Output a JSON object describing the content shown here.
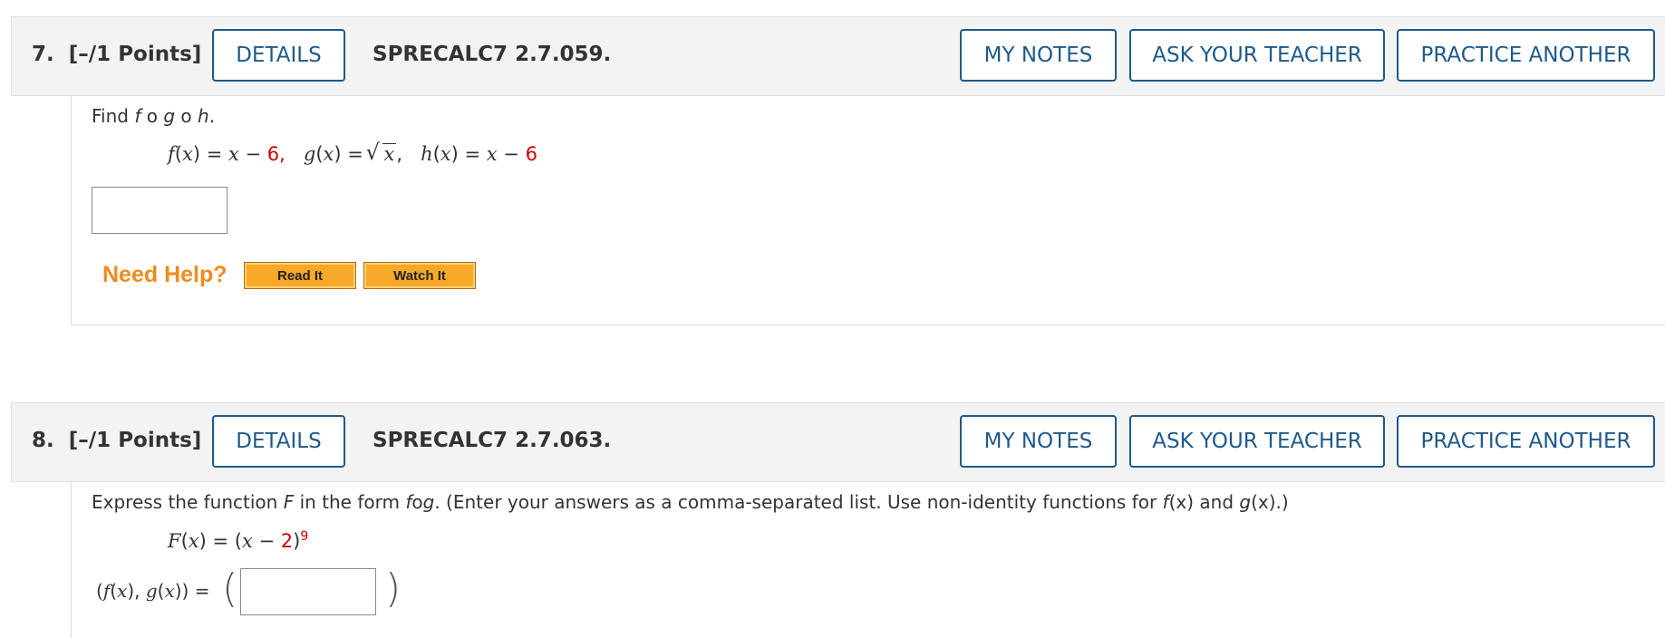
{
  "q7": {
    "number": "7.",
    "points": "[–/1 Points]",
    "details_label": "DETAILS",
    "code": "SPRECALC7 2.7.059.",
    "my_notes_label": "MY NOTES",
    "ask_teacher_label": "ASK YOUR TEACHER",
    "practice_label": "PRACTICE ANOTHER",
    "prompt": {
      "find": "Find ",
      "f": "f",
      "circ1": " o ",
      "g": "g",
      "circ2": " o ",
      "h": "h",
      "period": "."
    },
    "math": {
      "f_lhs": "f",
      "f_mid": "(",
      "f_x": "x",
      "f_eq": ") = ",
      "f_x2": "x",
      "f_minus": " − ",
      "f_const": "6",
      "comma1": ",",
      "g_lhs": "g",
      "g_open": "(",
      "g_x": "x",
      "g_eq": ") = ",
      "g_rad": "x",
      "comma2": ",",
      "h_lhs": "h",
      "h_open": "(",
      "h_x": "x",
      "h_eq": ") = ",
      "h_x2": "x",
      "h_minus": " − ",
      "h_const": "6"
    },
    "answer_value": "",
    "need_help": "Need Help?",
    "read_it": "Read It",
    "watch_it": "Watch It"
  },
  "q8": {
    "number": "8.",
    "points": "[–/1 Points]",
    "details_label": "DETAILS",
    "code": "SPRECALC7 2.7.063.",
    "my_notes_label": "MY NOTES",
    "ask_teacher_label": "ASK YOUR TEACHER",
    "practice_label": "PRACTICE ANOTHER",
    "prompt": {
      "part1": "Express the function ",
      "F": "F",
      "part2": " in the form ",
      "fog_f": "f",
      "fog_o": "o",
      "fog_g": "g",
      "part3": ". (Enter your answers as a comma-separated list. Use non-identity functions for  ",
      "fx_f": "f",
      "fx_rest": "(x)",
      "and": " and ",
      "gx_g": "g",
      "gx_rest": "(x)",
      "end": ".)"
    },
    "math": {
      "F_lhs": "F",
      "open": "(",
      "x": "x",
      "eq": ") = (",
      "x2": "x",
      "minus": " − ",
      "const": "2",
      "close": ")",
      "exp": "9"
    },
    "answer_label_a": "(",
    "answer_label_f": "f",
    "answer_label_b": "(",
    "answer_label_x1": "x",
    "answer_label_c": "), ",
    "answer_label_g": "g",
    "answer_label_d": "(",
    "answer_label_x2": "x",
    "answer_label_e": ")) = ",
    "open_paren": "(",
    "close_paren": ")",
    "answer_value": ""
  },
  "colors": {
    "header_bg": "#f3f3f3",
    "button_border": "#1e5a8a",
    "button_text": "#1e5a8a",
    "need_help": "#f08a1c",
    "help_button": "#f7a928",
    "red_constant": "#cc0000"
  }
}
